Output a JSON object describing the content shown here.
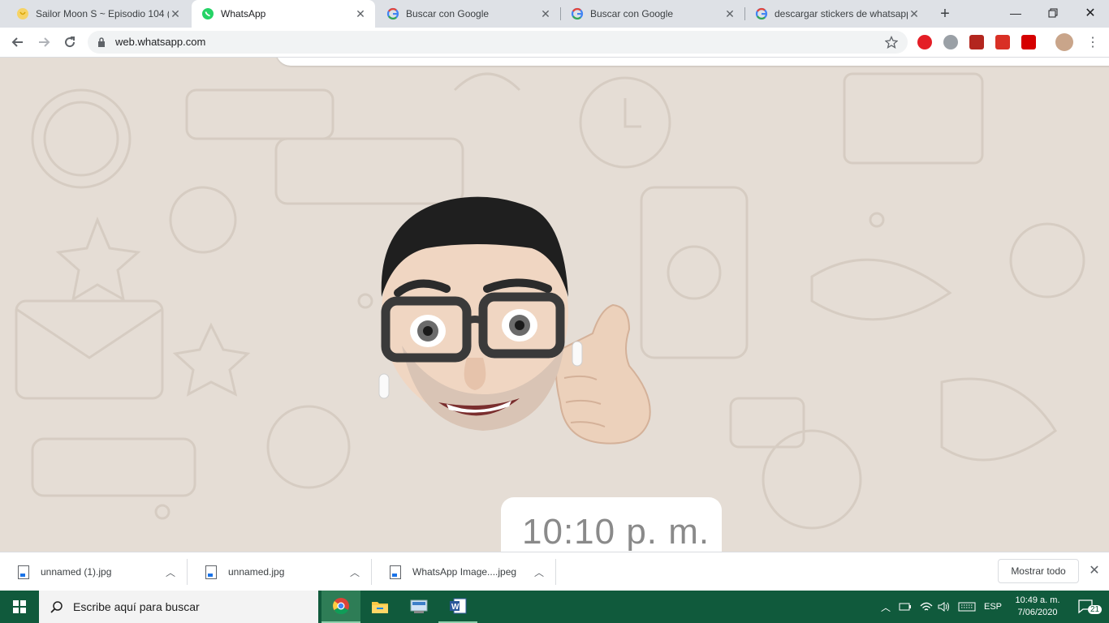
{
  "browser": {
    "tabs": [
      {
        "title": "Sailor Moon S ~ Episodio 104 (",
        "favicon": "sailor-moon-icon",
        "active": false
      },
      {
        "title": "WhatsApp",
        "favicon": "whatsapp-icon",
        "active": true
      },
      {
        "title": "Buscar con Google",
        "favicon": "google-icon",
        "active": false
      },
      {
        "title": "Buscar con Google",
        "favicon": "google-icon",
        "active": false
      },
      {
        "title": "descargar stickers de whatsapp",
        "favicon": "google-icon",
        "active": false
      }
    ],
    "url": "web.whatsapp.com"
  },
  "chat": {
    "message_time": "10:10 p. m.",
    "sticker": "memoji-thumbs-up-sticker",
    "background_color": "#e5ddd5"
  },
  "downloads": {
    "items": [
      {
        "name": "unnamed (1).jpg"
      },
      {
        "name": "unnamed.jpg"
      },
      {
        "name": "WhatsApp Image....jpeg"
      }
    ],
    "show_all": "Mostrar todo"
  },
  "taskbar": {
    "search_placeholder": "Escribe aquí para buscar",
    "language": "ESP",
    "time": "10:49 a. m.",
    "date": "7/06/2020",
    "notification_count": "21"
  }
}
